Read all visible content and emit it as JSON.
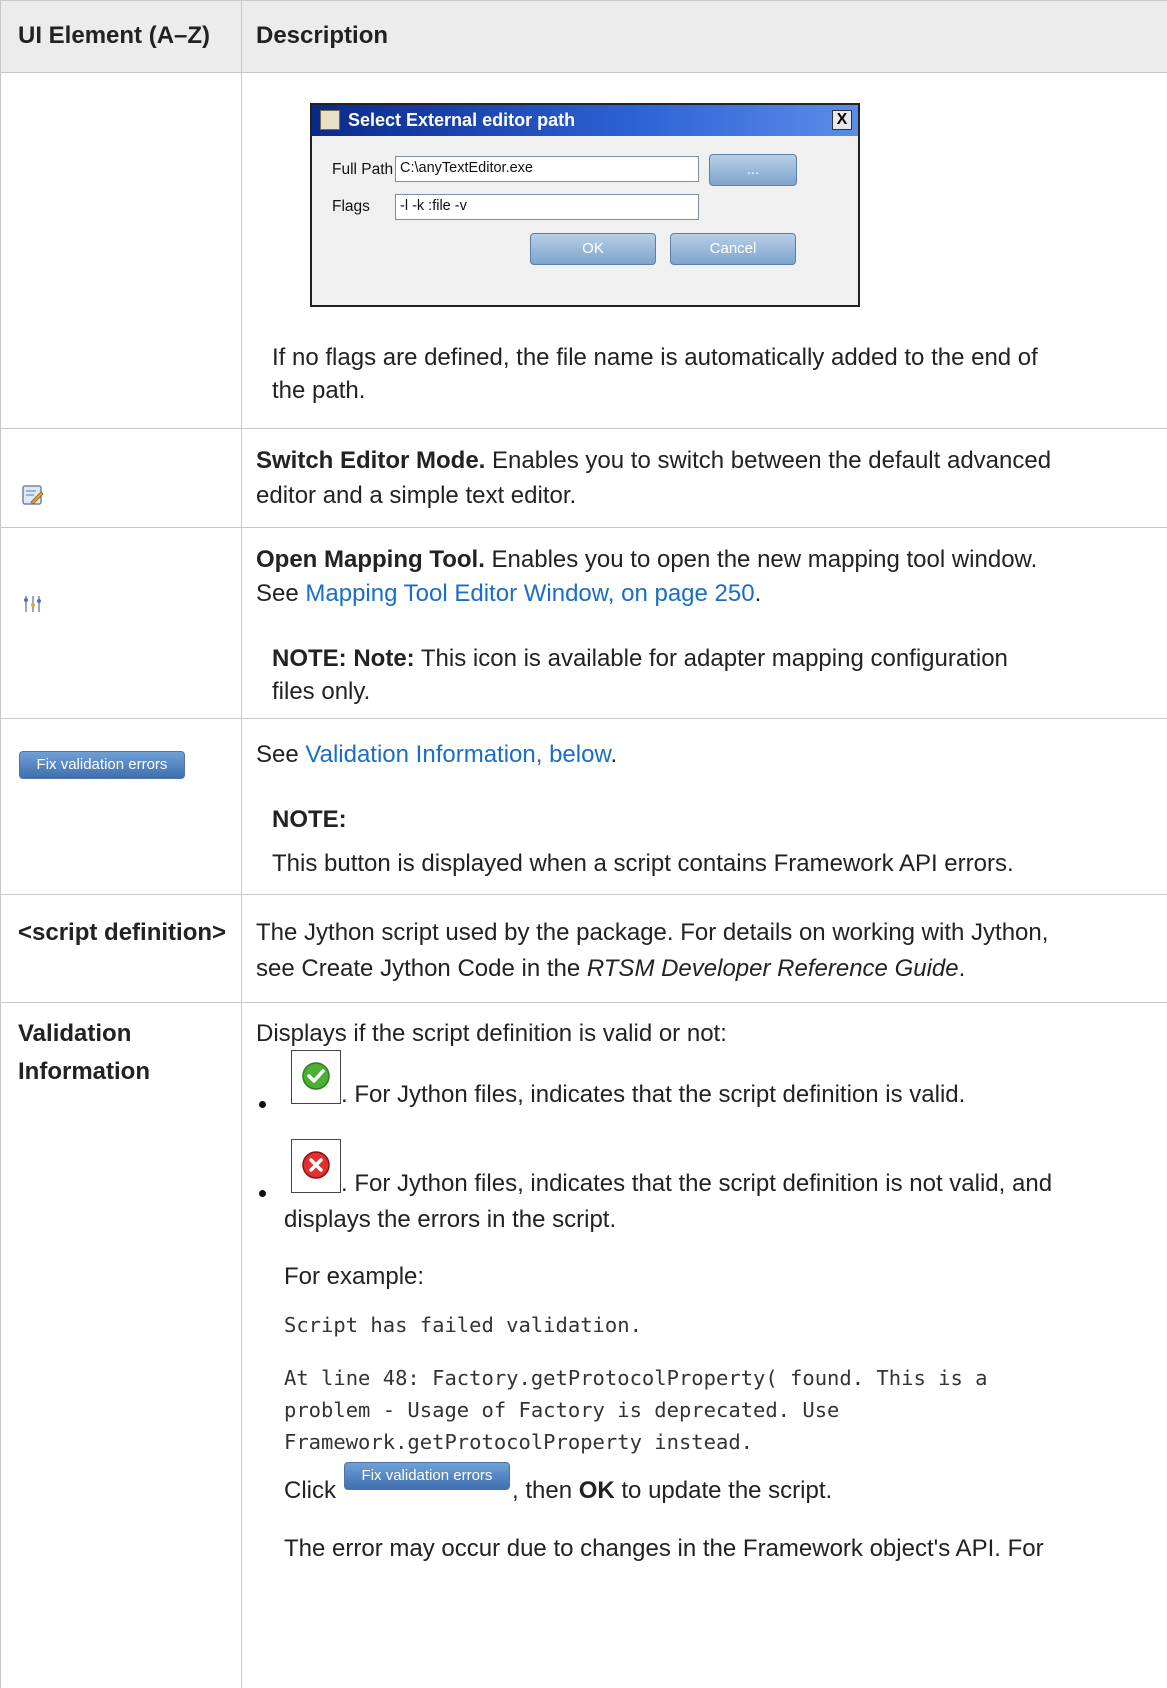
{
  "table": {
    "header": {
      "col1": "UI Element (A–Z)",
      "col2": "Description"
    }
  },
  "dialog": {
    "title": "Select External editor path",
    "full_path_label": "Full Path",
    "full_path_value": "C:\\anyTextEditor.exe",
    "browse_label": "...",
    "flags_label": "Flags",
    "flags_value": "-l -k :file -v",
    "ok_label": "OK",
    "cancel_label": "Cancel",
    "close_label": "X"
  },
  "row1": {
    "text": "If no flags are defined, the file name is automatically added to the end of",
    "text2": "the path."
  },
  "row2": {
    "icon": "switch-editor-mode-icon",
    "title": "Switch Editor Mode.",
    "text": " Enables you to switch between the default advanced",
    "text2": "editor and a simple text editor."
  },
  "row3": {
    "icon": "open-mapping-tool-icon",
    "title": "Open Mapping Tool.",
    "text": " Enables you to open the new mapping tool window.",
    "see": "See ",
    "link": "Mapping Tool Editor Window, on page 250",
    "period": ".",
    "note_bold": "NOTE: Note:",
    "note_text": " This icon is available for adapter mapping configuration",
    "note_text2": "files only."
  },
  "row4": {
    "button": "Fix validation errors",
    "see": "See ",
    "link": "Validation Information, below",
    "period": ".",
    "note_bold": "NOTE:",
    "note_text": "This button is displayed when a script contains Framework API errors."
  },
  "row5": {
    "element": "<script definition>",
    "text": "The Jython script used by the package. For details on working with Jython,",
    "text2a": "see Create Jython Code in the ",
    "text2_italic": "RTSM Developer Reference Guide",
    "text2b": "."
  },
  "row6": {
    "element1": "Validation",
    "element2": "Information",
    "intro": "Displays if the script definition is valid or not:",
    "valid_text": ". For Jython files, indicates that the script definition is valid.",
    "invalid_text": ". For Jython files, indicates that the script definition is not valid, and",
    "invalid_text2": "displays the errors in the script.",
    "example_label": "For example:",
    "code_line1": "Script has failed validation.",
    "code_line2": "At line 48: Factory.getProtocolProperty( found. This is a",
    "code_line3": "problem - Usage of Factory is deprecated. Use",
    "code_line4": "Framework.getProtocolProperty instead.",
    "click": "Click ",
    "button": "Fix validation errors",
    "then": ", then ",
    "ok": "OK",
    "update": " to update the script.",
    "last": "The error may occur due to changes in the Framework object's API. For"
  },
  "colors": {
    "link": "#1a6dc8",
    "header_bg": "#ececec",
    "border": "#c8c8c8"
  }
}
